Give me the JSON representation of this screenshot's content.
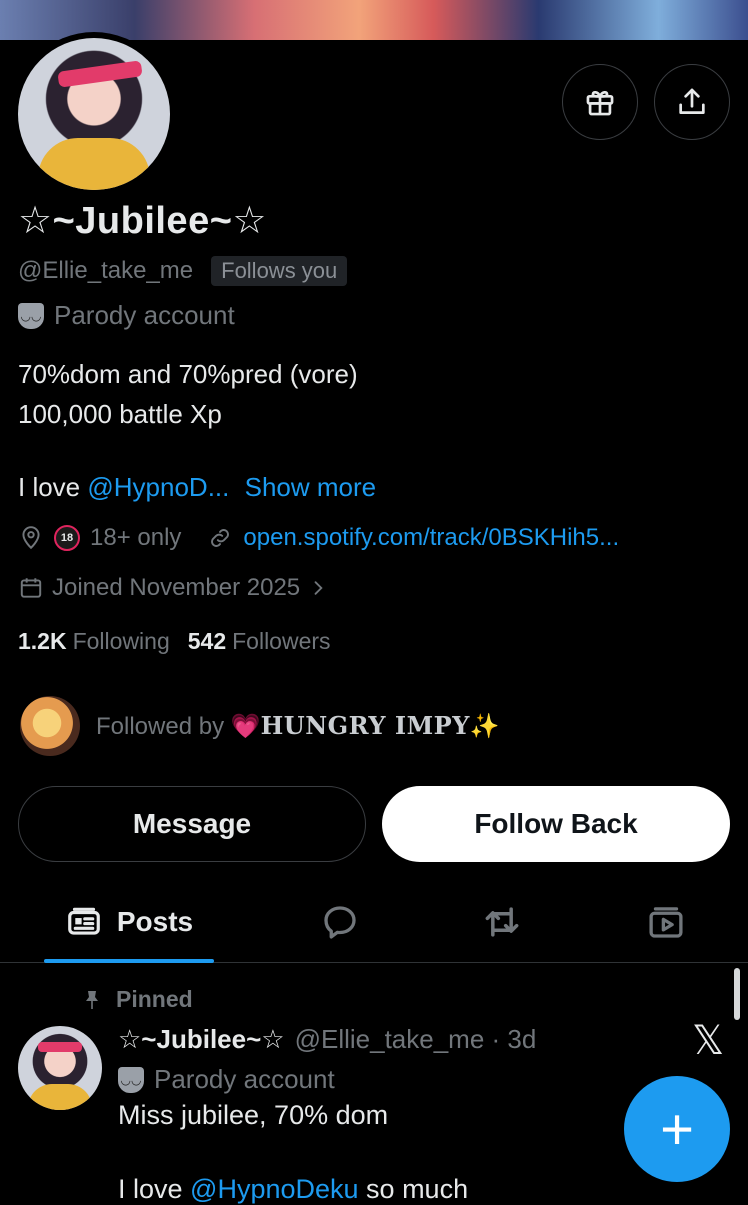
{
  "profile": {
    "display_name": "☆~Jubilee~☆",
    "handle": "@Ellie_take_me",
    "follows_you": "Follows you",
    "account_label": "Parody account",
    "bio": "70%dom and 70%pred (vore)\n 100,000 battle Xp",
    "bio_love_prefix": "I love ",
    "bio_mention": "@HypnoD...",
    "show_more": "Show more",
    "age_rating_icon_text": "18",
    "age_label": "18+ only",
    "website": "open.spotify.com/track/0BSKHih5...",
    "joined": "Joined November 2025",
    "following_count": "1.2K",
    "following_label": "Following",
    "followers_count": "542",
    "followers_label": "Followers",
    "followed_by_prefix": "Followed by",
    "followed_by_heart": "💗",
    "followed_by_name": "HUNGRY IMPY✨"
  },
  "actions": {
    "message": "Message",
    "follow_back": "Follow Back"
  },
  "tabs": {
    "posts_label": "Posts"
  },
  "pinned_post": {
    "pinned_label": "Pinned",
    "author_name": "☆~Jubilee~☆",
    "author_handle": "@Ellie_take_me · 3d",
    "author_label": "Parody account",
    "text_line1": "Miss jubilee, 70% dom",
    "text_line2_prefix": "I love ",
    "text_line2_mention": "@HypnoDeku",
    "text_line2_suffix": " so much",
    "x_logo": "𝕏"
  },
  "fab": {
    "symbol": "+"
  },
  "colors": {
    "accent": "#1d9bf0",
    "background": "#000000",
    "text_primary": "#e7e9ea",
    "text_secondary": "#71767b"
  }
}
